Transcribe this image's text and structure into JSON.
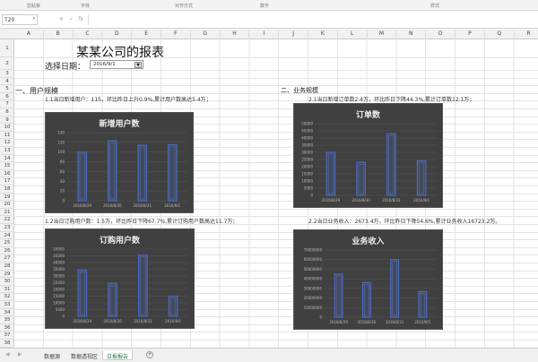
{
  "ribbon": {
    "groups": [
      "剪贴板",
      "字体",
      "对齐方式",
      "数字",
      "样式"
    ]
  },
  "formula_bar": {
    "name_box": "T20",
    "cancel": "✕",
    "enter": "✓",
    "fx": "fx",
    "value": ""
  },
  "sheet": {
    "columns": [
      "A",
      "B",
      "C",
      "D",
      "E",
      "F",
      "G",
      "H",
      "I",
      "J",
      "K",
      "L",
      "M",
      "N",
      "O",
      "P",
      "Q",
      "R"
    ],
    "row_count": 38
  },
  "report": {
    "title": "某某公司的报表",
    "date_label": "选择日期：",
    "date_value": "2016/9/1",
    "section1": "一、用户规模",
    "note_1_1": "1.1当日新增用户：115，环比昨日上升0.9%,累计用户数高达5.4万；",
    "note_1_2": "1.2当日订购用户数：1.5万，环比昨日下降67.7%,累计订购用户数高达11.7万；",
    "section2": "二、业务规模",
    "note_2_1": "2.1当日新增订单数2.4万，环比昨日下降44.3%,累计订单数12.1万；",
    "note_2_2": "2.2当日业务收入：2673.4万，环比昨日下降54.6%,累计业务收入16723.2万。"
  },
  "tabs": [
    "数据源",
    "数据透视区",
    "日报报告"
  ],
  "active_tab": 2,
  "colors": {
    "chart_bg": "#404040",
    "bar_stroke": "#4a6bc4",
    "bar_fill": "#414a5e",
    "excel_green": "#217346"
  },
  "chart_data": [
    {
      "type": "bar",
      "title": "新增用户数",
      "categories": [
        "2016/8/29",
        "2016/8/30",
        "2016/8/31",
        "2016/9/1"
      ],
      "values": [
        100,
        123,
        114,
        115
      ],
      "ylim": [
        0,
        140
      ],
      "yticks": [
        "0",
        "20",
        "40",
        "60",
        "80",
        "100",
        "120",
        "140"
      ]
    },
    {
      "type": "bar",
      "title": "订单数",
      "categories": [
        "2016/8/29",
        "2016/8/30",
        "2016/8/31",
        "2016/9/1"
      ],
      "values": [
        30000,
        23000,
        43000,
        24000
      ],
      "ylim": [
        0,
        50000
      ],
      "yticks": [
        "0",
        "5000",
        "10000",
        "15000",
        "20000",
        "25000",
        "30000",
        "35000",
        "40000",
        "45000",
        "50000"
      ]
    },
    {
      "type": "bar",
      "title": "订购用户数",
      "categories": [
        "2016/8/29",
        "2016/8/30",
        "2016/8/31",
        "2016/9/1"
      ],
      "values": [
        34500,
        24500,
        45500,
        15000
      ],
      "ylim": [
        0,
        50000
      ],
      "yticks": [
        "0",
        "5000",
        "10000",
        "15000",
        "20000",
        "25000",
        "30000",
        "35000",
        "40000",
        "45000",
        "50000"
      ]
    },
    {
      "type": "bar",
      "title": "业务收入",
      "categories": [
        "2016/8/29",
        "2016/8/30",
        "2016/8/31",
        "2016/9/1"
      ],
      "values": [
        45000000,
        36000000,
        60000000,
        26734000
      ],
      "ylim": [
        0,
        70000000
      ],
      "yticks": [
        "0",
        "10000000",
        "20000000",
        "30000000",
        "40000000",
        "50000000",
        "60000000",
        "70000000"
      ]
    }
  ]
}
